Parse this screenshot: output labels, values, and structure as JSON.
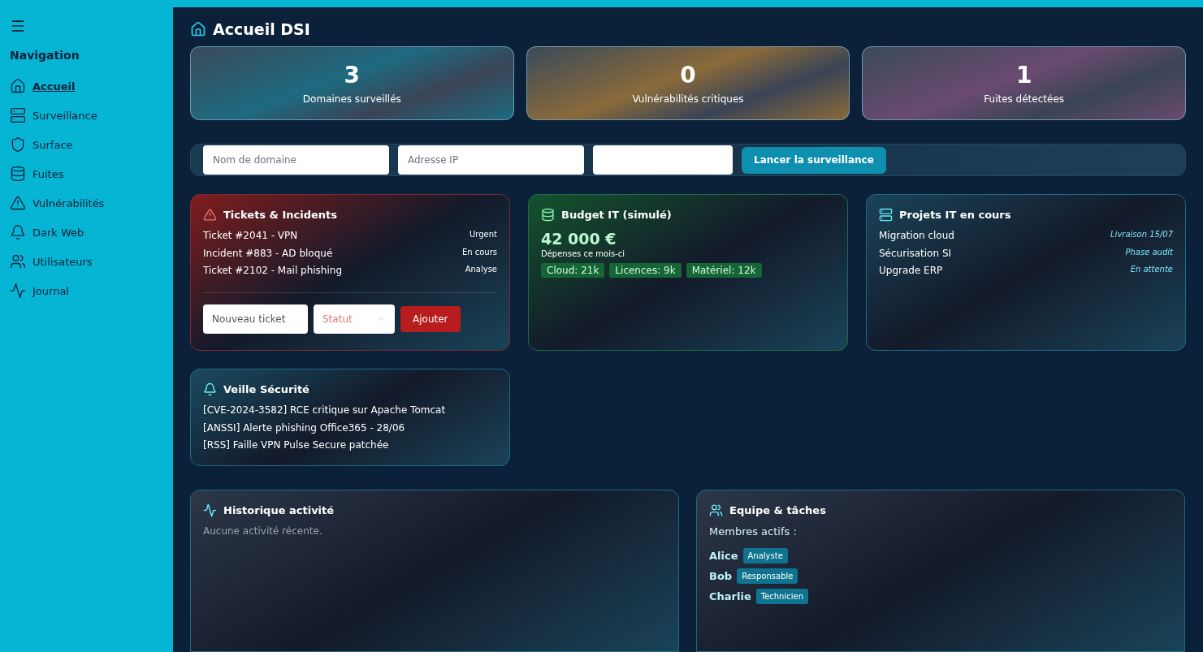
{
  "sidebar": {
    "title": "Navigation",
    "items": [
      {
        "label": "Accueil",
        "selected": true
      },
      {
        "label": "Surveillance",
        "selected": false
      },
      {
        "label": "Surface",
        "selected": false
      },
      {
        "label": "Fuites",
        "selected": false
      },
      {
        "label": "Vulnérabilités",
        "selected": false
      },
      {
        "label": "Dark Web",
        "selected": false
      },
      {
        "label": "Utilisateurs",
        "selected": false
      },
      {
        "label": "Journal",
        "selected": false
      }
    ]
  },
  "page_title": "Accueil DSI",
  "stats": [
    {
      "value": "3",
      "label": "Domaines surveillés",
      "color": "#1e6a80"
    },
    {
      "value": "0",
      "label": "Vulnérabilités critiques",
      "color": "#8a6a3a"
    },
    {
      "value": "1",
      "label": "Fuites détectées",
      "color": "#6a4a70"
    }
  ],
  "scan_form": {
    "fields": [
      {
        "kind": "text",
        "placeholder": "Nom de domaine"
      },
      {
        "kind": "text",
        "placeholder": "Adresse IP"
      },
      {
        "kind": "text"
      }
    ],
    "button": "Lancer la surveillance"
  },
  "tickets": {
    "title": "Tickets & Incidents",
    "items": [
      {
        "label": "Ticket #2041 - VPN",
        "status": "Urgent"
      },
      {
        "label": "Incident #883 - AD bloqué",
        "status": "En cours"
      },
      {
        "label": "Ticket #2102 - Mail phishing",
        "status": "Analyse"
      }
    ],
    "new_ticket_placeholder": "Nouveau ticket",
    "status_placeholder": "Statut",
    "add_button": "Ajouter"
  },
  "budget": {
    "title": "Budget IT (simulé)",
    "amount": "42 000 €",
    "caption": "Dépenses ce mois-ci",
    "tags": [
      "Cloud: 21k",
      "Licences: 9k",
      "Matériel: 12k"
    ]
  },
  "projects": {
    "title": "Projets IT en cours",
    "items": [
      {
        "name": "Migration cloud",
        "status": "Livraison 15/07"
      },
      {
        "name": "Sécurisation SI",
        "status": "Phase audit"
      },
      {
        "name": "Upgrade ERP",
        "status": "En attente"
      }
    ]
  },
  "watch": {
    "title": "Veille Sécurité",
    "items": [
      "[CVE-2024-3582] RCE critique sur Apache Tomcat",
      "[ANSSI] Alerte phishing Office365 - 28/06",
      "[RSS] Faille VPN Pulse Secure patchée"
    ]
  },
  "history": {
    "title": "Historique activité",
    "empty": "Aucune activité récente."
  },
  "team": {
    "title": "Equipe & tâches",
    "members_label": "Membres actifs :",
    "members": [
      {
        "name": "Alice",
        "role": "Analyste"
      },
      {
        "name": "Bob",
        "role": "Responsable"
      },
      {
        "name": "Charlie",
        "role": "Technicien"
      }
    ]
  }
}
